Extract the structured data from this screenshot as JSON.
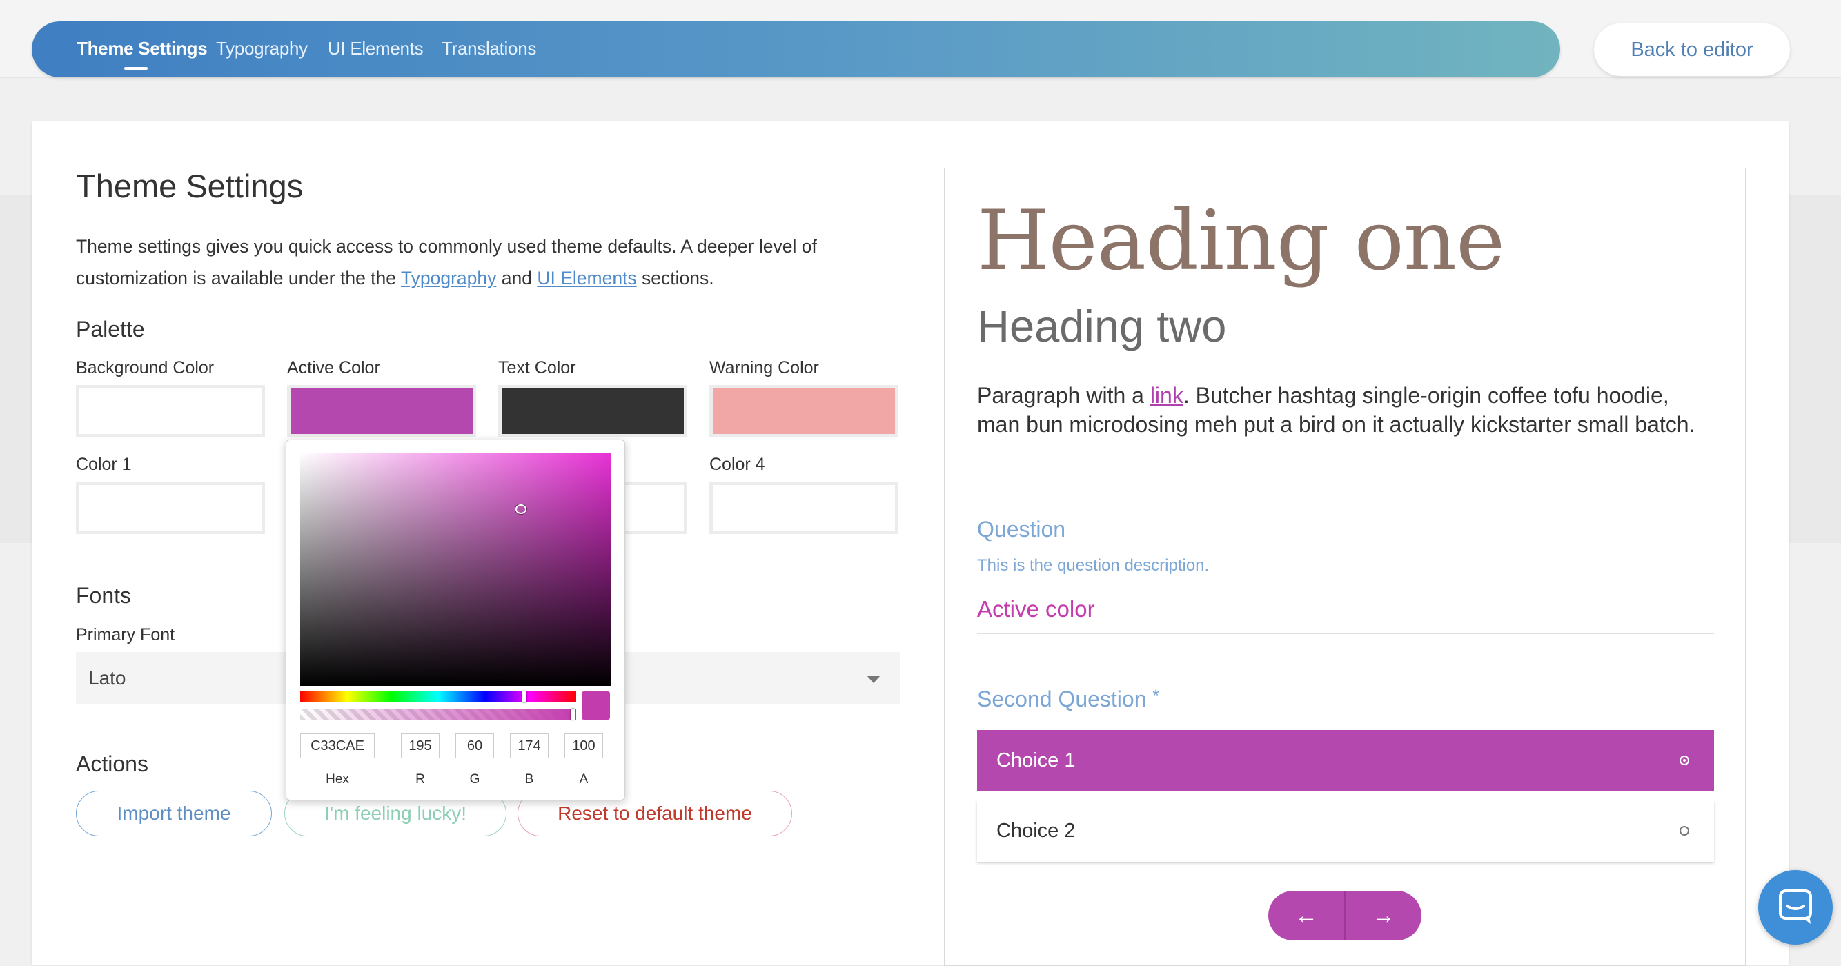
{
  "nav": {
    "tabs": [
      "Theme Settings",
      "Typography",
      "UI Elements",
      "Translations"
    ],
    "back_label": "Back to editor"
  },
  "settings": {
    "title": "Theme Settings",
    "desc_before": "Theme settings gives you quick access to commonly used theme defaults. A deeper level of customization is available under the the ",
    "desc_link1": "Typography",
    "desc_mid": " and ",
    "desc_link2": "UI Elements",
    "desc_after": " sections.",
    "palette_title": "Palette",
    "palette": {
      "background_label": "Background Color",
      "background_value": "#ffffff",
      "active_label": "Active Color",
      "active_value": "#b448ae",
      "text_label": "Text Color",
      "text_value": "#333333",
      "warning_label": "Warning Color",
      "warning_value": "#f2a7a7",
      "color1_label": "Color 1",
      "color1_value": "#ffffff",
      "color4_label": "Color 4",
      "color4_value": "#ffffff"
    },
    "fonts_title": "Fonts",
    "primary_font_label": "Primary Font",
    "primary_font_value": "Lato",
    "actions_title": "Actions",
    "actions": {
      "import": "Import theme",
      "lucky": "I'm feeling lucky!",
      "reset": "Reset to default theme"
    }
  },
  "picker": {
    "hex": "C33CAE",
    "r": "195",
    "g": "60",
    "b": "174",
    "a": "100",
    "labels": {
      "hex": "Hex",
      "r": "R",
      "g": "G",
      "b": "B",
      "a": "A"
    },
    "preview_color": "#c33cae"
  },
  "preview": {
    "heading1": "Heading one",
    "heading2": "Heading two",
    "para_before": "Paragraph with a ",
    "para_link": "link",
    "para_after": ". Butcher hashtag single-origin coffee tofu hoodie, man bun microdosing meh put a bird on it actually kickstarter small batch.",
    "question1": "Question",
    "question1_desc": "This is the question description.",
    "active_color_text": "Active color",
    "question2": "Second Question",
    "question2_star": "*",
    "choices": [
      "Choice 1",
      "Choice 2"
    ],
    "prev_icon": "←",
    "next_icon": "→"
  }
}
